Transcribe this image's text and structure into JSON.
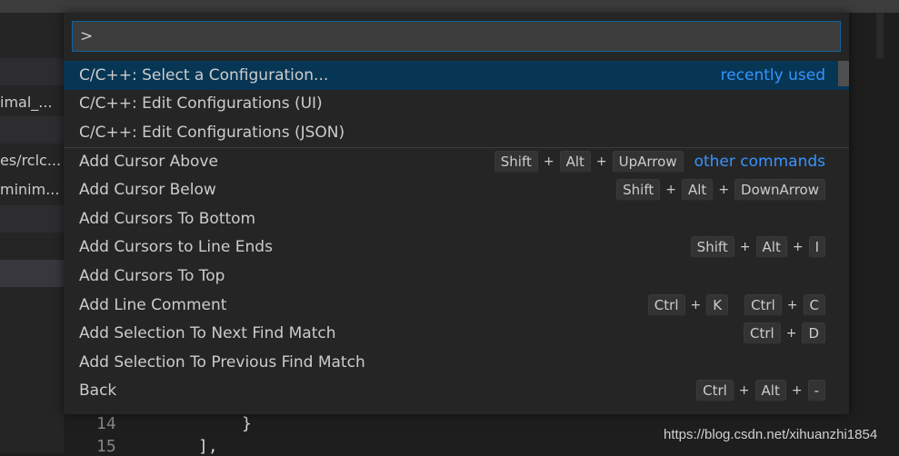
{
  "sidebar": {
    "rows": [
      {
        "text": "imal_..."
      },
      {
        "text": "es/rclc..."
      },
      {
        "text": "minim..."
      }
    ]
  },
  "editor": {
    "lines": [
      {
        "number": "14",
        "text": "}"
      },
      {
        "number": "15",
        "text": "],"
      }
    ]
  },
  "watermark": "https://blog.csdn.net/xihuanzhi1854",
  "command_palette": {
    "input_value": ">",
    "items": [
      {
        "label": "C/C++: Select a Configuration...",
        "tag": "recently used",
        "keys": []
      },
      {
        "label": "C/C++: Edit Configurations (UI)",
        "tag": "",
        "keys": []
      },
      {
        "label": "C/C++: Edit Configurations (JSON)",
        "tag": "",
        "keys": []
      },
      {
        "label": "Add Cursor Above",
        "tag": "other commands",
        "keys": [
          [
            "Shift",
            "Alt",
            "UpArrow"
          ]
        ]
      },
      {
        "label": "Add Cursor Below",
        "tag": "",
        "keys": [
          [
            "Shift",
            "Alt",
            "DownArrow"
          ]
        ]
      },
      {
        "label": "Add Cursors To Bottom",
        "tag": "",
        "keys": []
      },
      {
        "label": "Add Cursors to Line Ends",
        "tag": "",
        "keys": [
          [
            "Shift",
            "Alt",
            "I"
          ]
        ]
      },
      {
        "label": "Add Cursors To Top",
        "tag": "",
        "keys": []
      },
      {
        "label": "Add Line Comment",
        "tag": "",
        "keys": [
          [
            "Ctrl",
            "K"
          ],
          [
            "Ctrl",
            "C"
          ]
        ]
      },
      {
        "label": "Add Selection To Next Find Match",
        "tag": "",
        "keys": [
          [
            "Ctrl",
            "D"
          ]
        ]
      },
      {
        "label": "Add Selection To Previous Find Match",
        "tag": "",
        "keys": []
      },
      {
        "label": "Back",
        "tag": "",
        "keys": [
          [
            "Ctrl",
            "Alt",
            "-"
          ]
        ]
      }
    ]
  },
  "colors": {
    "selection": "#073655",
    "accent_link": "#3794ff",
    "input_border": "#0e639c"
  }
}
